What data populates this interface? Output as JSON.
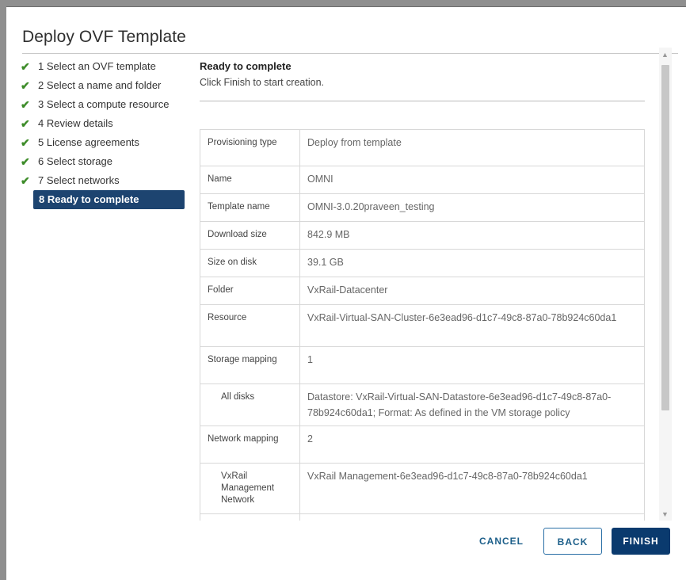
{
  "dialog": {
    "title": "Deploy OVF Template"
  },
  "steps": [
    {
      "label": "1 Select an OVF template",
      "done": true
    },
    {
      "label": "2 Select a name and folder",
      "done": true
    },
    {
      "label": "3 Select a compute resource",
      "done": true
    },
    {
      "label": "4 Review details",
      "done": true
    },
    {
      "label": "5 License agreements",
      "done": true
    },
    {
      "label": "6 Select storage",
      "done": true
    },
    {
      "label": "7 Select networks",
      "done": true
    },
    {
      "label": "8 Ready to complete",
      "done": false,
      "active": true
    }
  ],
  "check_glyph": "✔",
  "main": {
    "heading": "Ready to complete",
    "subheading": "Click Finish to start creation."
  },
  "summary": {
    "rows": [
      {
        "label": "Provisioning type",
        "value": "Deploy from template"
      },
      {
        "label": "Name",
        "value": "OMNI"
      },
      {
        "label": "Template name",
        "value": "OMNI-3.0.20praveen_testing"
      },
      {
        "label": "Download size",
        "value": "842.9 MB"
      },
      {
        "label": "Size on disk",
        "value": "39.1 GB"
      },
      {
        "label": "Folder",
        "value": "VxRail-Datacenter"
      },
      {
        "label": "Resource",
        "value": "VxRail-Virtual-SAN-Cluster-6e3ead96-d1c7-49c8-87a0-78b924c60da1"
      },
      {
        "label": "Storage mapping",
        "value": "1"
      },
      {
        "label": "All disks",
        "value": "Datastore: VxRail-Virtual-SAN-Datastore-6e3ead96-d1c7-49c8-87a0-78b924c60da1; Format: As defined in the VM storage policy"
      },
      {
        "label": "Network mapping",
        "value": "2"
      },
      {
        "label": "VxRail Management Network",
        "value": "VxRail Management-6e3ead96-d1c7-49c8-87a0-78b924c60da1"
      }
    ]
  },
  "buttons": {
    "cancel": "CANCEL",
    "back": "BACK",
    "finish": "FINISH"
  },
  "colors": {
    "active_step": "#1d4470",
    "check": "#3d8c29",
    "finish": "#0a3a6e"
  }
}
